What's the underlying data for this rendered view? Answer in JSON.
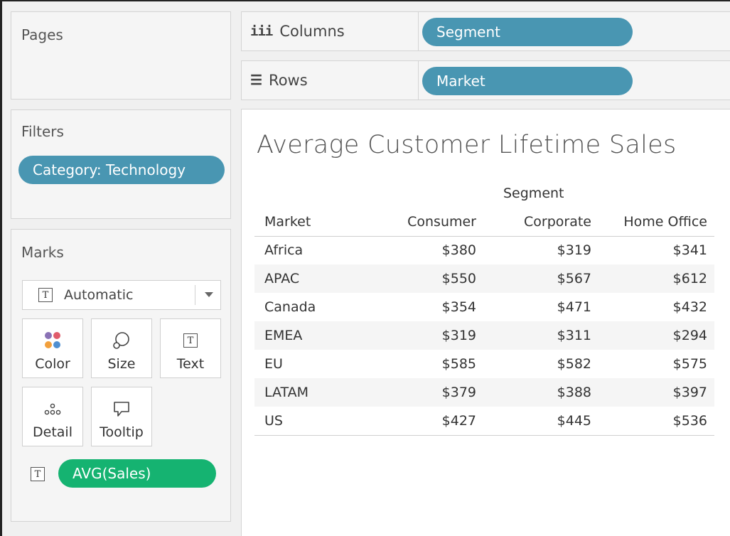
{
  "pages": {
    "title": "Pages"
  },
  "filters": {
    "title": "Filters",
    "items": [
      "Category: Technology"
    ]
  },
  "marks": {
    "title": "Marks",
    "mark_type": "Automatic",
    "buttons": {
      "color": "Color",
      "size": "Size",
      "text": "Text",
      "detail": "Detail",
      "tooltip": "Tooltip"
    },
    "field": "AVG(Sales)"
  },
  "shelves": {
    "columns": {
      "label": "Columns",
      "pill": "Segment"
    },
    "rows": {
      "label": "Rows",
      "pill": "Market"
    }
  },
  "view": {
    "title": "Average Customer Lifetime Sales",
    "segment_header": "Segment",
    "columns": [
      "Market",
      "Consumer",
      "Corporate",
      "Home Office"
    ],
    "rows": [
      [
        "Africa",
        "$380",
        "$319",
        "$341"
      ],
      [
        "APAC",
        "$550",
        "$567",
        "$612"
      ],
      [
        "Canada",
        "$354",
        "$471",
        "$432"
      ],
      [
        "EMEA",
        "$319",
        "$311",
        "$294"
      ],
      [
        "EU",
        "$585",
        "$582",
        "$575"
      ],
      [
        "LATAM",
        "$379",
        "$388",
        "$397"
      ],
      [
        "US",
        "$427",
        "$445",
        "$536"
      ]
    ]
  },
  "colors": {
    "dimension_pill": "#4996b2",
    "measure_pill": "#15b371"
  }
}
